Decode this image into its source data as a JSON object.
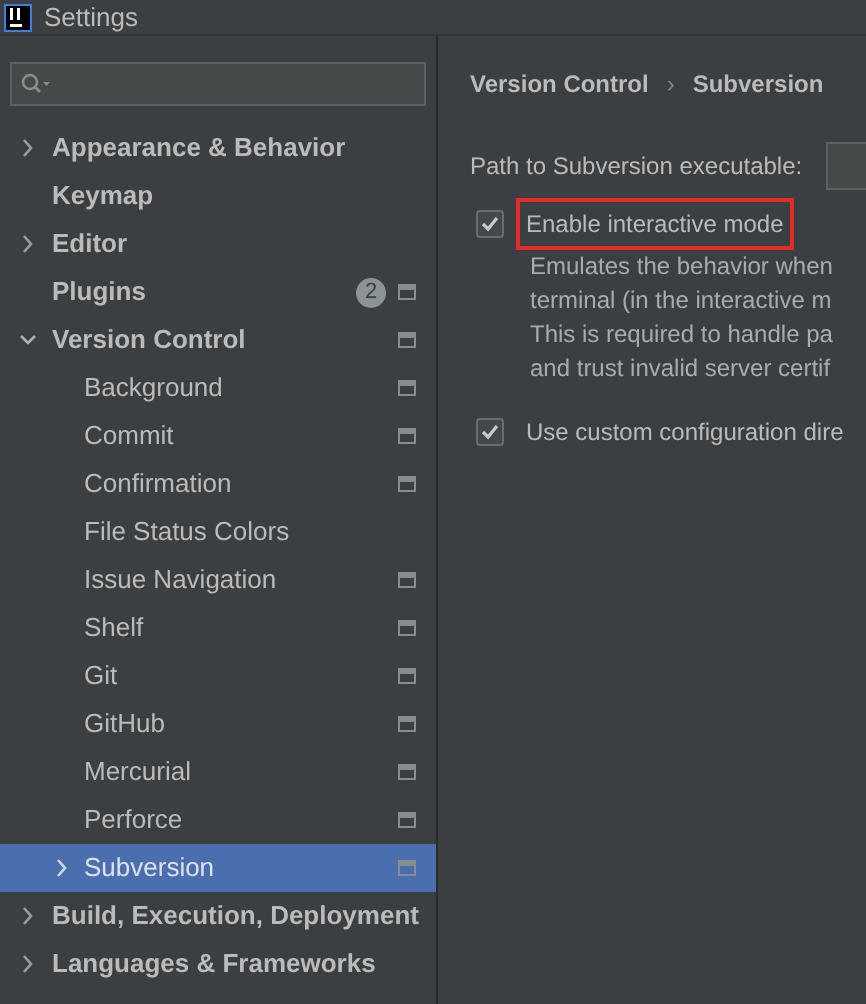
{
  "window": {
    "title": "Settings"
  },
  "sidebar": {
    "items": [
      {
        "label": "Appearance & Behavior",
        "expandable": true,
        "expanded": false,
        "scope_icon": false,
        "selected": false
      },
      {
        "label": "Keymap",
        "expandable": false,
        "scope_icon": false,
        "selected": false
      },
      {
        "label": "Editor",
        "expandable": true,
        "expanded": false,
        "scope_icon": false,
        "selected": false
      },
      {
        "label": "Plugins",
        "expandable": false,
        "scope_icon": true,
        "badge": "2",
        "selected": false
      },
      {
        "label": "Version Control",
        "expandable": true,
        "expanded": true,
        "scope_icon": true,
        "selected": false,
        "children": [
          {
            "label": "Background",
            "expandable": false,
            "scope_icon": true,
            "selected": false
          },
          {
            "label": "Commit",
            "expandable": false,
            "scope_icon": true,
            "selected": false
          },
          {
            "label": "Confirmation",
            "expandable": false,
            "scope_icon": true,
            "selected": false
          },
          {
            "label": "File Status Colors",
            "expandable": false,
            "scope_icon": false,
            "selected": false
          },
          {
            "label": "Issue Navigation",
            "expandable": false,
            "scope_icon": true,
            "selected": false
          },
          {
            "label": "Shelf",
            "expandable": false,
            "scope_icon": true,
            "selected": false
          },
          {
            "label": "Git",
            "expandable": false,
            "scope_icon": true,
            "selected": false
          },
          {
            "label": "GitHub",
            "expandable": false,
            "scope_icon": true,
            "selected": false
          },
          {
            "label": "Mercurial",
            "expandable": false,
            "scope_icon": true,
            "selected": false
          },
          {
            "label": "Perforce",
            "expandable": false,
            "scope_icon": true,
            "selected": false
          },
          {
            "label": "Subversion",
            "expandable": true,
            "expanded": false,
            "scope_icon": true,
            "selected": true
          }
        ]
      },
      {
        "label": "Build, Execution, Deployment",
        "expandable": true,
        "expanded": false,
        "scope_icon": false,
        "selected": false
      },
      {
        "label": "Languages & Frameworks",
        "expandable": true,
        "expanded": false,
        "scope_icon": false,
        "selected": false
      }
    ]
  },
  "breadcrumb": [
    "Version Control",
    "Subversion"
  ],
  "breadcrumb_separator": "›",
  "path_label": "Path to Subversion executable:",
  "options": [
    {
      "label": "Enable interactive mode",
      "checked": true,
      "highlighted": true,
      "description": [
        "Emulates the behavior when",
        "terminal (in the interactive m",
        "This is required to handle pa",
        "and trust invalid server certif"
      ]
    },
    {
      "label": "Use custom configuration dire",
      "checked": true,
      "highlighted": false
    }
  ]
}
